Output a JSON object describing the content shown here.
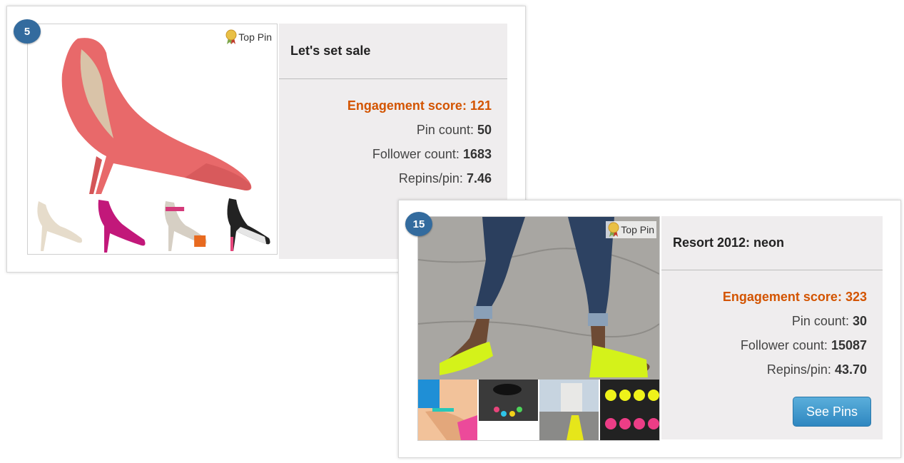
{
  "cards": [
    {
      "rank": "5",
      "badge": "Top Pin",
      "title": "Let's set sale",
      "engagement_label": "Engagement score:",
      "engagement_value": "121",
      "pin_label": "Pin count:",
      "pin_value": "50",
      "follower_label": "Follower count:",
      "follower_value": "1683",
      "repins_label": "Repins/pin:",
      "repins_value": "7.46"
    },
    {
      "rank": "15",
      "badge": "Top Pin",
      "title": "Resort 2012: neon",
      "engagement_label": "Engagement score:",
      "engagement_value": "323",
      "pin_label": "Pin count:",
      "pin_value": "30",
      "follower_label": "Follower count:",
      "follower_value": "15087",
      "repins_label": "Repins/pin:",
      "repins_value": "43.70",
      "button": "See Pins"
    }
  ],
  "colors": {
    "rank_badge": "#336b9e",
    "engagement": "#d35400",
    "panel": "#efedee",
    "button": "#3b95c9"
  },
  "icons": [
    "medal-icon"
  ]
}
